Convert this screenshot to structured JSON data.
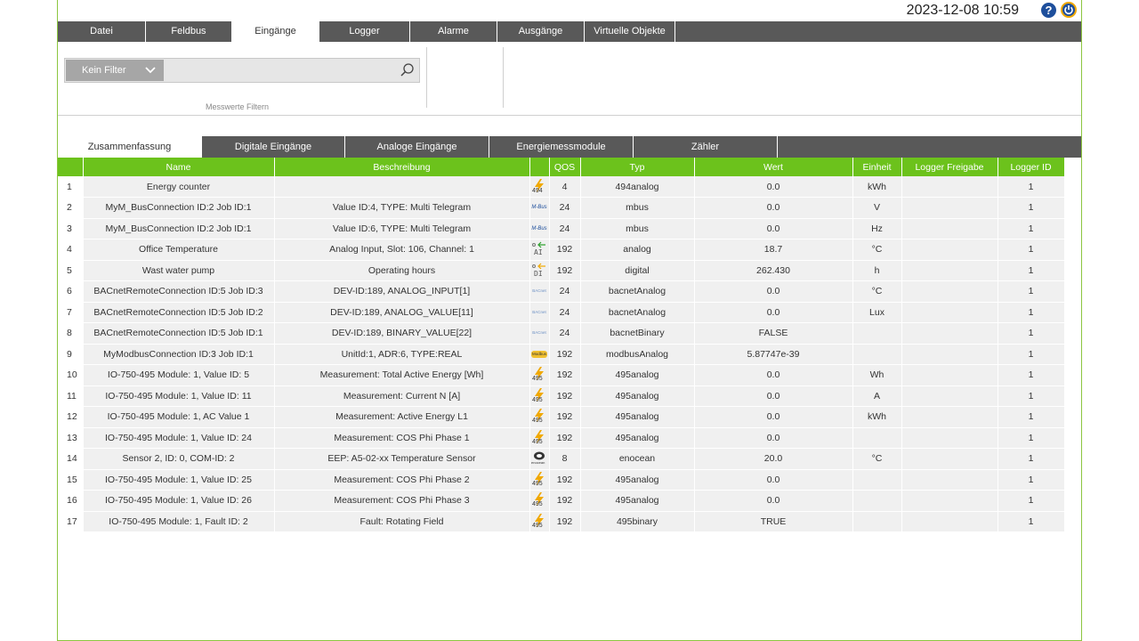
{
  "header": {
    "datetime": "2023-12-08 10:59",
    "help_glyph": "?"
  },
  "menu": [
    "Datei",
    "Feldbus",
    "Eingänge",
    "Logger",
    "Alarme",
    "Ausgänge",
    "Virtuelle Objekte"
  ],
  "filter": {
    "selected": "Kein Filter",
    "value": "",
    "caption": "Messwerte Filtern"
  },
  "subtabs": [
    "Zusammenfassung",
    "Digitale Eingänge",
    "Analoge Eingänge",
    "Energiemessmodule",
    "Zähler"
  ],
  "table": {
    "columns": [
      "",
      "Name",
      "Beschreibung",
      "",
      "QOS",
      "Typ",
      "Wert",
      "Einheit",
      "Logger Freigabe",
      "Logger ID"
    ],
    "rows": [
      {
        "idx": "1",
        "name": "Energy counter",
        "desc": "",
        "icon": "494-energy-icon",
        "icon_text": "494",
        "qos": "4",
        "typ": "494analog",
        "wert": "0.0",
        "einheit": "kWh",
        "freigabe": "",
        "logger_id": "1"
      },
      {
        "idx": "2",
        "name": "MyM_BusConnection ID:2 Job ID:1",
        "desc": "Value ID:4, TYPE: Multi Telegram",
        "icon": "mbus-icon",
        "icon_text": "M-Bus",
        "qos": "24",
        "typ": "mbus",
        "wert": "0.0",
        "einheit": "V",
        "freigabe": "",
        "logger_id": "1"
      },
      {
        "idx": "3",
        "name": "MyM_BusConnection ID:2 Job ID:1",
        "desc": "Value ID:6, TYPE: Multi Telegram",
        "icon": "mbus-icon",
        "icon_text": "M-Bus",
        "qos": "24",
        "typ": "mbus",
        "wert": "0.0",
        "einheit": "Hz",
        "freigabe": "",
        "logger_id": "1"
      },
      {
        "idx": "4",
        "name": "Office Temperature",
        "desc": "Analog Input, Slot: 106, Channel: 1",
        "icon": "analog-input-icon",
        "icon_text": "AI",
        "qos": "192",
        "typ": "analog",
        "wert": "18.7",
        "einheit": "°C",
        "freigabe": "",
        "logger_id": "1"
      },
      {
        "idx": "5",
        "name": "Wast water pump",
        "desc": "Operating hours",
        "icon": "digital-input-icon",
        "icon_text": "DI",
        "qos": "192",
        "typ": "digital",
        "wert": "262.430",
        "einheit": "h",
        "freigabe": "",
        "logger_id": "1"
      },
      {
        "idx": "6",
        "name": "BACnetRemoteConnection ID:5 Job ID:3",
        "desc": "DEV-ID:189, ANALOG_INPUT[1]",
        "icon": "bacnet-icon",
        "icon_text": "BACnet",
        "qos": "24",
        "typ": "bacnetAnalog",
        "wert": "0.0",
        "einheit": "°C",
        "freigabe": "",
        "logger_id": "1"
      },
      {
        "idx": "7",
        "name": "BACnetRemoteConnection ID:5 Job ID:2",
        "desc": "DEV-ID:189, ANALOG_VALUE[11]",
        "icon": "bacnet-icon",
        "icon_text": "BACnet",
        "qos": "24",
        "typ": "bacnetAnalog",
        "wert": "0.0",
        "einheit": "Lux",
        "freigabe": "",
        "logger_id": "1"
      },
      {
        "idx": "8",
        "name": "BACnetRemoteConnection ID:5 Job ID:1",
        "desc": "DEV-ID:189, BINARY_VALUE[22]",
        "icon": "bacnet-icon",
        "icon_text": "BACnet",
        "qos": "24",
        "typ": "bacnetBinary",
        "wert": "FALSE",
        "einheit": "",
        "freigabe": "",
        "logger_id": "1"
      },
      {
        "idx": "9",
        "name": "MyModbusConnection ID:3 Job ID:1",
        "desc": "UnitId:1, ADR:6, TYPE:REAL",
        "icon": "modbus-icon",
        "icon_text": "Modbus",
        "qos": "192",
        "typ": "modbusAnalog",
        "wert": "5.87747e-39",
        "einheit": "",
        "freigabe": "",
        "logger_id": "1"
      },
      {
        "idx": "10",
        "name": "IO-750-495 Module: 1, Value ID: 5",
        "desc": "Measurement: Total Active Energy [Wh]",
        "icon": "495-energy-icon",
        "icon_text": "495",
        "qos": "192",
        "typ": "495analog",
        "wert": "0.0",
        "einheit": "Wh",
        "freigabe": "",
        "logger_id": "1"
      },
      {
        "idx": "11",
        "name": "IO-750-495 Module: 1, Value ID: 11",
        "desc": "Measurement: Current N [A]",
        "icon": "495-energy-icon",
        "icon_text": "495",
        "qos": "192",
        "typ": "495analog",
        "wert": "0.0",
        "einheit": "A",
        "freigabe": "",
        "logger_id": "1"
      },
      {
        "idx": "12",
        "name": "IO-750-495 Module: 1, AC Value 1",
        "desc": "Measurement: Active Energy L1",
        "icon": "495-energy-icon",
        "icon_text": "495",
        "qos": "192",
        "typ": "495analog",
        "wert": "0.0",
        "einheit": "kWh",
        "freigabe": "",
        "logger_id": "1"
      },
      {
        "idx": "13",
        "name": "IO-750-495 Module: 1, Value ID: 24",
        "desc": "Measurement: COS Phi Phase 1",
        "icon": "495-energy-icon",
        "icon_text": "495",
        "qos": "192",
        "typ": "495analog",
        "wert": "0.0",
        "einheit": "",
        "freigabe": "",
        "logger_id": "1"
      },
      {
        "idx": "14",
        "name": "Sensor 2, ID: 0, COM-ID: 2",
        "desc": "EEP: A5-02-xx Temperature Sensor",
        "icon": "enocean-icon",
        "icon_text": "enocean",
        "qos": "8",
        "typ": "enocean",
        "wert": "20.0",
        "einheit": "°C",
        "freigabe": "",
        "logger_id": "1"
      },
      {
        "idx": "15",
        "name": "IO-750-495 Module: 1, Value ID: 25",
        "desc": "Measurement: COS Phi Phase 2",
        "icon": "495-energy-icon",
        "icon_text": "495",
        "qos": "192",
        "typ": "495analog",
        "wert": "0.0",
        "einheit": "",
        "freigabe": "",
        "logger_id": "1"
      },
      {
        "idx": "16",
        "name": "IO-750-495 Module: 1, Value ID: 26",
        "desc": "Measurement: COS Phi Phase 3",
        "icon": "495-energy-icon",
        "icon_text": "495",
        "qos": "192",
        "typ": "495analog",
        "wert": "0.0",
        "einheit": "",
        "freigabe": "",
        "logger_id": "1"
      },
      {
        "idx": "17",
        "name": "IO-750-495 Module: 1, Fault ID: 2",
        "desc": "Fault: Rotating Field",
        "icon": "495-energy-icon",
        "icon_text": "495",
        "qos": "192",
        "typ": "495binary",
        "wert": "TRUE",
        "einheit": "",
        "freigabe": "",
        "logger_id": "1"
      }
    ]
  },
  "colors": {
    "accent_green": "#6cc21c",
    "bar_gray": "#595959",
    "brand_blue": "#1e4f9c",
    "lightning_orange": "#f0a800"
  }
}
